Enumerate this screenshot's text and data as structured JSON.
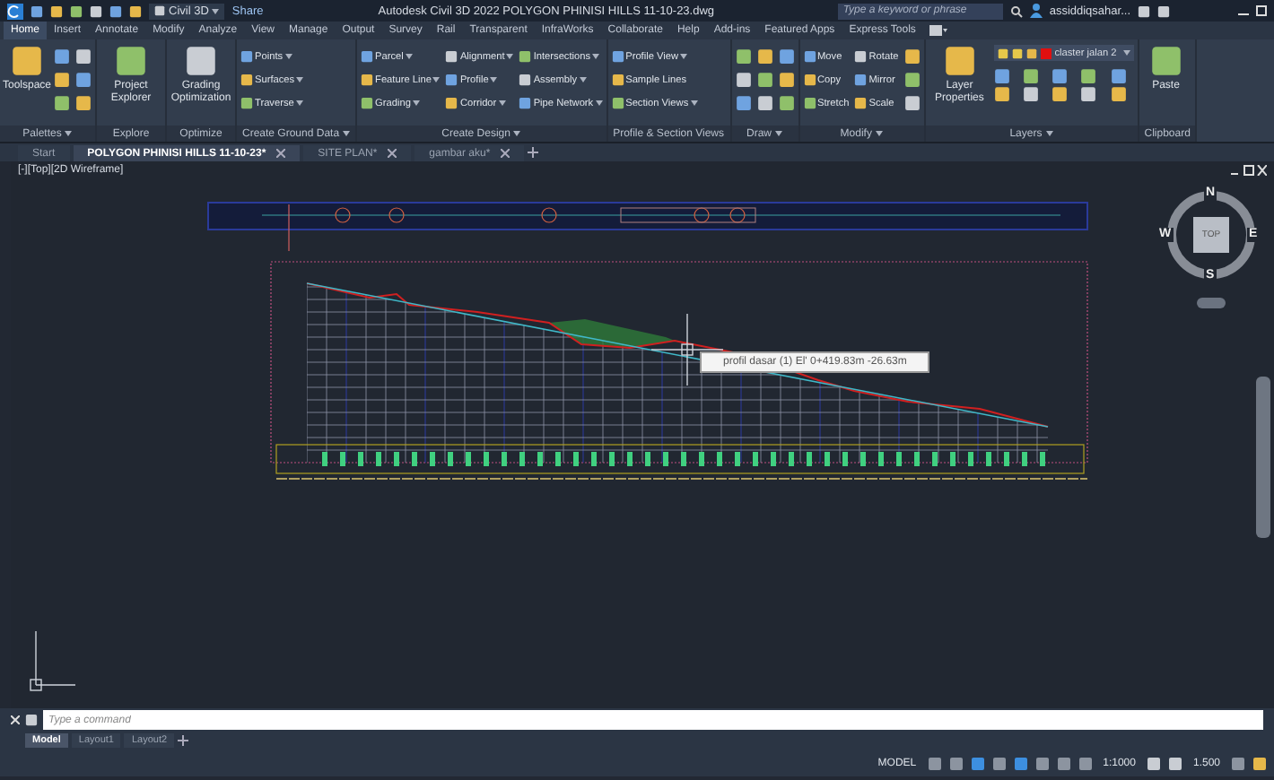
{
  "title_bar": {
    "workspace": "Civil 3D",
    "share": "Share",
    "title": "Autodesk Civil 3D 2022   POLYGON PHINISI HILLS 11-10-23.dwg",
    "search": {
      "placeholder": "Type a keyword or phrase"
    },
    "user": "assiddiqsahar..."
  },
  "ribbon_tabs": [
    {
      "label": "Home",
      "selected": true
    },
    {
      "label": "Insert",
      "selected": false
    },
    {
      "label": "Annotate",
      "selected": false
    },
    {
      "label": "Modify",
      "selected": false
    },
    {
      "label": "Analyze",
      "selected": false
    },
    {
      "label": "View",
      "selected": false
    },
    {
      "label": "Manage",
      "selected": false
    },
    {
      "label": "Output",
      "selected": false
    },
    {
      "label": "Survey",
      "selected": false
    },
    {
      "label": "Rail",
      "selected": false
    },
    {
      "label": "Transparent",
      "selected": false
    },
    {
      "label": "InfraWorks",
      "selected": false
    },
    {
      "label": "Collaborate",
      "selected": false
    },
    {
      "label": "Help",
      "selected": false
    },
    {
      "label": "Add-ins",
      "selected": false
    },
    {
      "label": "Featured Apps",
      "selected": false
    },
    {
      "label": "Express Tools",
      "selected": false
    }
  ],
  "panels": [
    {
      "title": "Palettes",
      "dropdown": true,
      "tools": [
        {
          "kind": "large",
          "label": "Toolspace"
        },
        {
          "kind": "icon"
        },
        {
          "kind": "icon"
        },
        {
          "kind": "icon"
        },
        {
          "kind": "icon"
        },
        {
          "kind": "icon"
        },
        {
          "kind": "icon"
        }
      ]
    },
    {
      "title": "Explore",
      "dropdown": false,
      "tools": [
        {
          "kind": "large",
          "label": "Project Explorer"
        }
      ]
    },
    {
      "title": "Optimize",
      "dropdown": false,
      "tools": [
        {
          "kind": "large",
          "label": "Grading Optimization"
        }
      ]
    },
    {
      "title": "Create Ground Data",
      "dropdown": true,
      "tools": [
        {
          "kind": "small",
          "label": "Points",
          "dropdown": true
        },
        {
          "kind": "small",
          "label": "Surfaces",
          "dropdown": true
        },
        {
          "kind": "small",
          "label": "Traverse",
          "dropdown": true
        }
      ]
    },
    {
      "title": "Create Design",
      "dropdown": true,
      "tools": [
        {
          "kind": "small",
          "label": "Parcel",
          "dropdown": true
        },
        {
          "kind": "small",
          "label": "Feature Line",
          "dropdown": true
        },
        {
          "kind": "small",
          "label": "Grading",
          "dropdown": true
        },
        {
          "kind": "small",
          "label": "Alignment",
          "dropdown": true
        },
        {
          "kind": "small",
          "label": "Profile",
          "dropdown": true
        },
        {
          "kind": "small",
          "label": "Corridor",
          "dropdown": true
        },
        {
          "kind": "small",
          "label": "Intersections",
          "dropdown": true
        },
        {
          "kind": "small",
          "label": "Assembly",
          "dropdown": true
        },
        {
          "kind": "small",
          "label": "Pipe Network",
          "dropdown": true
        }
      ]
    },
    {
      "title": "Profile & Section Views",
      "dropdown": false,
      "tools": [
        {
          "kind": "small",
          "label": "Profile View",
          "dropdown": true
        },
        {
          "kind": "small",
          "label": "Sample Lines",
          "dropdown": false
        },
        {
          "kind": "small",
          "label": "Section Views",
          "dropdown": true
        }
      ]
    },
    {
      "title": "Draw",
      "dropdown": true,
      "tools": [
        {
          "kind": "icon"
        },
        {
          "kind": "icon"
        },
        {
          "kind": "icon"
        },
        {
          "kind": "icon"
        },
        {
          "kind": "icon"
        },
        {
          "kind": "icon"
        },
        {
          "kind": "icon"
        },
        {
          "kind": "icon"
        },
        {
          "kind": "icon"
        }
      ]
    },
    {
      "title": "Modify",
      "dropdown": true,
      "tools": [
        {
          "kind": "small",
          "label": "Move",
          "dropdown": false
        },
        {
          "kind": "small",
          "label": "Copy",
          "dropdown": false
        },
        {
          "kind": "small",
          "label": "Stretch",
          "dropdown": false
        },
        {
          "kind": "small",
          "label": "Rotate",
          "dropdown": false
        },
        {
          "kind": "small",
          "label": "Mirror",
          "dropdown": false
        },
        {
          "kind": "small",
          "label": "Scale",
          "dropdown": false
        },
        {
          "kind": "icon"
        },
        {
          "kind": "icon"
        },
        {
          "kind": "icon"
        }
      ]
    },
    {
      "title": "Layers",
      "dropdown": true,
      "tools": [
        {
          "kind": "large",
          "label": "Layer Properties"
        },
        {
          "kind": "layer",
          "label": "claster jalan 2",
          "color": "#e01010"
        },
        {
          "kind": "icon"
        },
        {
          "kind": "icon"
        },
        {
          "kind": "icon"
        },
        {
          "kind": "icon"
        },
        {
          "kind": "icon"
        },
        {
          "kind": "icon"
        },
        {
          "kind": "icon"
        },
        {
          "kind": "icon"
        },
        {
          "kind": "icon"
        },
        {
          "kind": "icon"
        }
      ]
    },
    {
      "title": "Clipboard",
      "dropdown": false,
      "tools": [
        {
          "kind": "large",
          "label": "Paste"
        }
      ]
    }
  ],
  "doc_tabs": [
    {
      "label": "Start",
      "selected": false,
      "closable": false
    },
    {
      "label": "POLYGON PHINISI HILLS 11-10-23*",
      "selected": true,
      "closable": true
    },
    {
      "label": "SITE PLAN*",
      "selected": false,
      "closable": true
    },
    {
      "label": "gambar aku*",
      "selected": false,
      "closable": true
    }
  ],
  "viewport": {
    "label": "[-][Top][2D Wireframe]",
    "viewcube": {
      "north": "N",
      "south": "S",
      "east": "E",
      "west": "W",
      "face": "TOP"
    },
    "tooltip": "profil dasar (1)   El'   0+419.83m   -26.63m"
  },
  "command_line": {
    "placeholder": "Type a command"
  },
  "layout_tabs": [
    {
      "label": "Model",
      "selected": true
    },
    {
      "label": "Layout1",
      "selected": false
    },
    {
      "label": "Layout2",
      "selected": false
    }
  ],
  "status_bar": {
    "space": "MODEL",
    "annotation_scale": "1:1000",
    "lineweight": "1.500"
  }
}
